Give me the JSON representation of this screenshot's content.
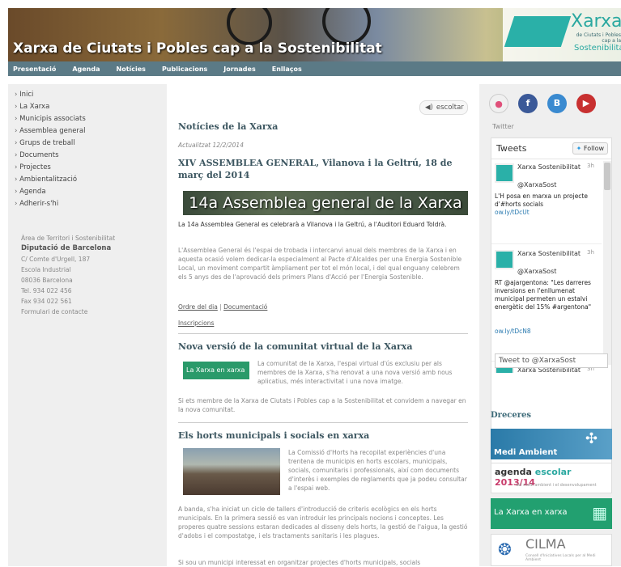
{
  "header": {
    "title": "Xarxa de Ciutats i Pobles cap a la Sostenibilitat",
    "logo_name": "Xarxa",
    "logo_sub": "de Ciutats i Pobles cap a la",
    "logo_sost": "Sostenibilitat"
  },
  "topnav": [
    "Presentació",
    "Agenda",
    "Notícies",
    "Publicacions",
    "Jornades",
    "Enllaços"
  ],
  "sidebar": {
    "items": [
      "Inici",
      "La Xarxa",
      "Municipis associats",
      "Assemblea general",
      "Grups de treball",
      "Documents",
      "Projectes",
      "Ambientalització",
      "Agenda",
      "Adherir-s'hi"
    ],
    "contact": {
      "area": "Àrea de Territori i Sostenibilitat",
      "org": "Diputació de Barcelona",
      "address1": "C/ Comte d'Urgell, 187",
      "address2": "Escola Industrial",
      "address3": "08036 Barcelona",
      "tel": "Tel. 934 022 456",
      "fax": "Fax 934 022 561",
      "form": "Formulari de contacte"
    }
  },
  "main": {
    "listen": "escoltar",
    "heading": "Notícies de la Xarxa",
    "updated": "Actualitzat 12/2/2014",
    "article1": {
      "title": "XIV ASSEMBLEA GENERAL, Vilanova i la Geltrú, 18 de març del 2014",
      "banner": "14a Assemblea general de la Xarxa",
      "lead": "La 14a Assemblea General es celebrarà a Vilanova i la Geltrú, a l'Auditori Eduard Toldrà.",
      "body": "L'Assemblea General és l'espai de trobada i intercanvi anual dels membres de la Xarxa i en aquesta ocasió volem dedicar-la especialment al Pacte d'Alcaldes per una Energia Sostenible Local, un moviment compartit àmpliament per tot el món local, i del qual enguany celebrem els 5 anys des de l'aprovació dels primers Plans d'Acció per l'Energia Sostenible.",
      "link1": "Ordre del dia",
      "sep": " | ",
      "link2": "Documentació",
      "link3": "Inscripcions"
    },
    "article2": {
      "title": "Nova versió de la comunitat virtual de la Xarxa",
      "img_label": "La Xarxa en xarxa",
      "body": "La comunitat de la Xarxa, l'espai virtual d'ús exclusiu per als membres de la Xarxa, s'ha renovat a una nova versió amb nous aplicatius, més interactivitat i una nova imatge.",
      "body2": "Si ets membre de la Xarxa de Ciutats i Pobles cap a la Sostenibilitat et convidem a navegar en la nova comunitat."
    },
    "article3": {
      "title": "Els horts municipals i socials en xarxa",
      "body": "La Comissió d'Horts ha recopilat experiències d'una trentena de municipis en horts escolars, municipals, socials, comunitaris i professionals, així com documents d'interès i exemples de reglaments que ja podeu consultar a l'espai web.",
      "body2": "A banda, s'ha iniciat un cicle de tallers d'introducció de criteris ecològics en els horts municipals. En la primera sessió es van introduir les principals nocions i conceptes. Les properes quatre sessions estaran dedicades al disseny dels horts, la gestió de l'aigua, la gestió d'adobs i el compostatge, i els tractaments sanitaris i les plagues.",
      "body3": "Si sou un municipi interessat en organitzar projectes d'horts municipals, socials"
    }
  },
  "right": {
    "social": [
      {
        "icon": "flickr-icon",
        "glyph": "●",
        "color": "#e0507a"
      },
      {
        "icon": "facebook-icon",
        "glyph": "f",
        "color": "#3b5998"
      },
      {
        "icon": "blog-icon",
        "glyph": "B",
        "color": "#3a8ad0"
      },
      {
        "icon": "youtube-icon",
        "glyph": "▶",
        "color": "#c83030"
      }
    ],
    "twitter_label": "Twitter",
    "tweets_title": "Tweets",
    "follow": "Follow",
    "tweets": [
      {
        "name": "Xarxa Sostenibilitat",
        "handle": "@XarxaSost",
        "time": "3h",
        "text": "L'H posa en marxa un projecte d'#horts socials",
        "link": "ow.ly/tDcUt"
      },
      {
        "name": "Xarxa Sostenibilitat",
        "handle": "@XarxaSost",
        "time": "3h",
        "text": "RT @ajargentona: \"Les darreres inversions en l'enllumenat municipal permeten un estalvi energètic del 15% #argentona\"",
        "link": "ow.ly/tDcN8"
      },
      {
        "name": "Xarxa Sostenibilitat",
        "handle": "",
        "time": "3h",
        "text": "",
        "link": ""
      }
    ],
    "tweet_to": "Tweet to @XarxaSost",
    "dreceres": "Dreceres",
    "shortcuts": {
      "medi": "Medi Ambient",
      "agenda_a": "agenda",
      "agenda_b": "escolar",
      "agenda_year": "2013/14",
      "agenda_sub": "del medi ambient i el desenvolupament",
      "xarxa": "La Xarxa en xarxa",
      "cilma": "CILMA",
      "cilma_sub": "Consell d'Iniciatives Locals per al Medi Ambient"
    }
  },
  "colors": {
    "nav": "#5b7a86",
    "heading": "#3c5660",
    "teal": "#2ab0a8"
  }
}
